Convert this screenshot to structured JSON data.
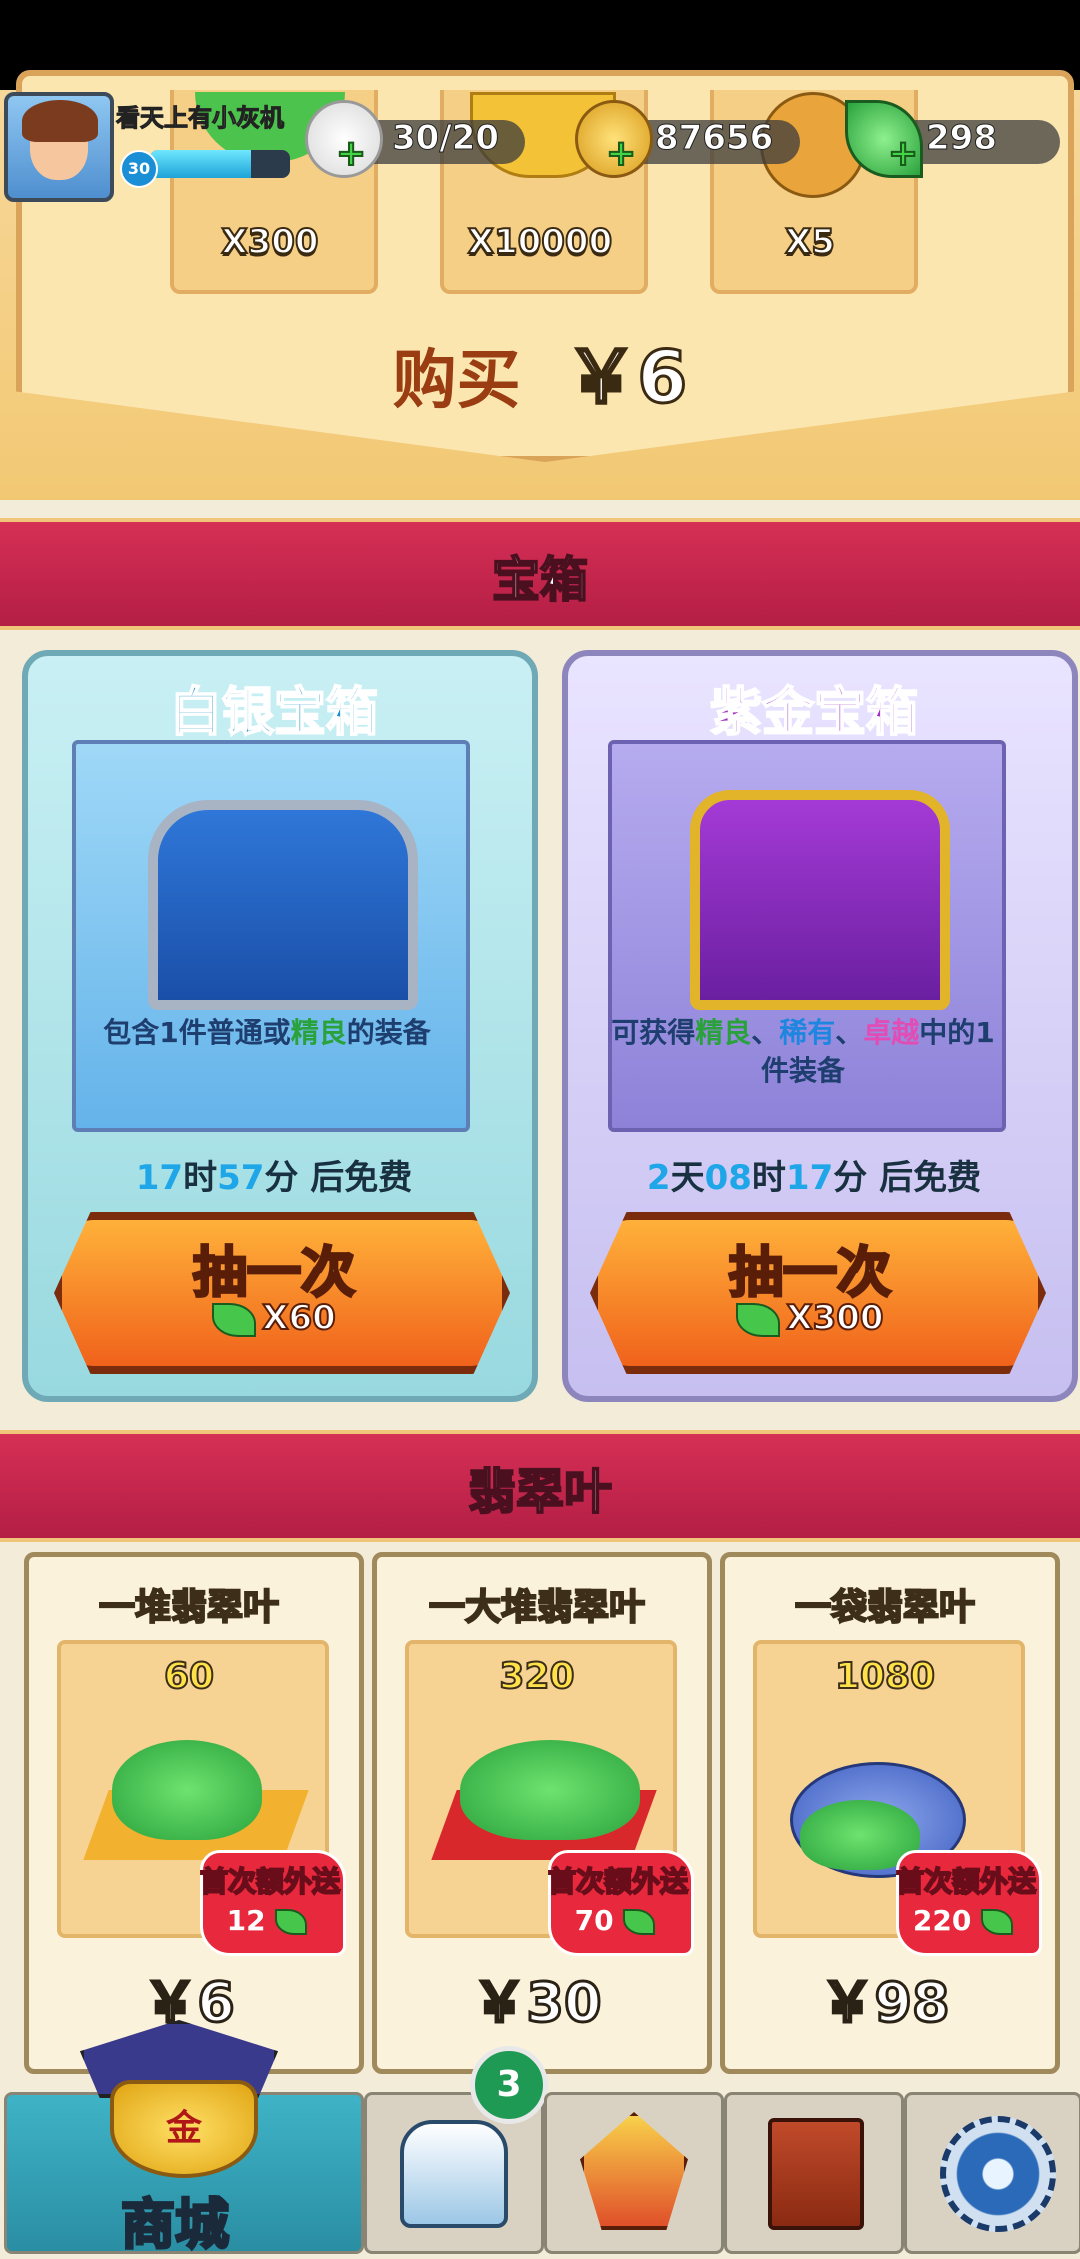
{
  "hud": {
    "username": "看天上有小灰机",
    "level": "30",
    "exp_fraction": 0.72,
    "stamina": "30/20",
    "gold": "87656",
    "leaves": "298",
    "plus": "+"
  },
  "pack": {
    "items": [
      {
        "count": "X300",
        "icon": "leaf-pile-icon"
      },
      {
        "count": "X10000",
        "icon": "gold-ingot-icon"
      },
      {
        "count": "X5",
        "icon": "monk-token-icon"
      }
    ],
    "buy_label": "购买",
    "buy_price": "￥6"
  },
  "chest_section": {
    "title": "宝箱",
    "chests": [
      {
        "title": "白银宝箱",
        "desc_parts": [
          "包含1件普通或",
          "精良",
          "的装备"
        ],
        "free_time": {
          "h": "17",
          "h_unit": "时",
          "m": "57",
          "m_unit": "分",
          "suffix": " 后免费"
        },
        "button": "抽一次",
        "cost": "X60"
      },
      {
        "title": "紫金宝箱",
        "desc_parts": [
          "可获得",
          "精良",
          "、",
          "稀有",
          "、",
          "卓越",
          "中的1件装备"
        ],
        "free_time": {
          "d": "2",
          "d_unit": "天",
          "h": "08",
          "h_unit": "时",
          "m": "17",
          "m_unit": "分",
          "suffix": " 后免费"
        },
        "button": "抽一次",
        "cost": "X300"
      }
    ]
  },
  "leaf_section": {
    "title": "翡翠叶",
    "bonus_label": "首次额外送",
    "items": [
      {
        "name": "一堆翡翠叶",
        "amount": "60",
        "bonus": "12",
        "price": "￥6"
      },
      {
        "name": "一大堆翡翠叶",
        "amount": "320",
        "bonus": "70",
        "price": "￥30"
      },
      {
        "name": "一袋翡翠叶",
        "amount": "1080",
        "bonus": "220",
        "price": "￥98"
      }
    ]
  },
  "nav": {
    "shop_label": "商城",
    "shop_icon_text": "金",
    "equipment_badge": "3",
    "icons": [
      "shop-icon",
      "armor-icon",
      "weapon-icon",
      "book-icon",
      "settings-gear-icon"
    ]
  },
  "colors": {
    "section_red": "#c8264c",
    "silver_title": "#1b8fc8",
    "gold_title": "#a032c6",
    "accent_green": "#2aa23c",
    "accent_blue": "#1fa6e8",
    "accent_pink": "#e24cb4"
  }
}
